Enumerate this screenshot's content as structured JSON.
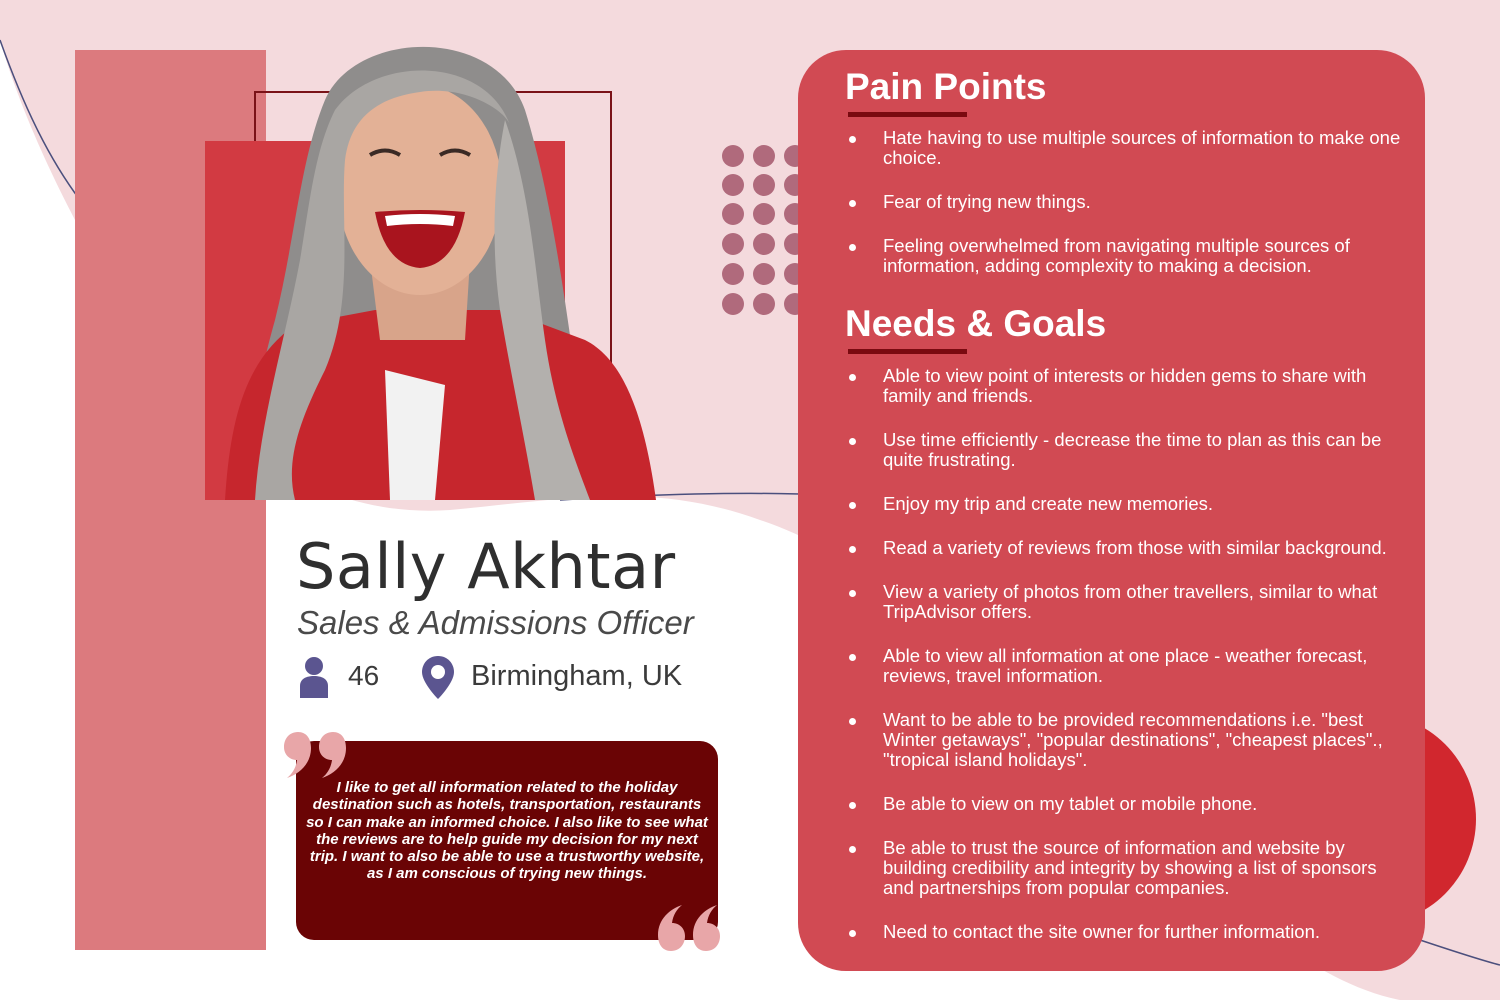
{
  "persona": {
    "name": "Sally Akhtar",
    "job_title": "Sales & Admissions Officer",
    "age": "46",
    "location": "Birmingham, UK",
    "quote": "I like to get all information related to the holiday destination such as hotels, transportation, restaurants so I can make an informed choice. I also like to see what the reviews are to help guide my decision for my next trip. I want to also be able to use a trustworthy website, as I am conscious of trying new things."
  },
  "icons": {
    "age": "person-icon",
    "location": "map-pin-icon",
    "quote_open": "quote-open-icon",
    "quote_close": "quote-close-icon"
  },
  "colors": {
    "accent": "#d14a53",
    "dark_accent": "#6a0405",
    "band": "#dc7a7e",
    "blush": "#f4dadd",
    "icon": "#5b5590"
  },
  "pain_points": {
    "title": "Pain Points",
    "items": [
      "Hate having to use multiple sources of information to make one choice.",
      "Fear of trying new things.",
      "Feeling overwhelmed from navigating multiple sources of information, adding complexity to making a decision."
    ]
  },
  "needs_goals": {
    "title": "Needs & Goals",
    "items": [
      "Able to view point of interests or hidden gems to share with family and friends.",
      "Use time efficiently - decrease the time to plan as this can be quite frustrating.",
      "Enjoy my trip and create new memories.",
      "Read a variety of reviews from those with similar background.",
      "View a variety of photos from other travellers, similar to what TripAdvisor offers.",
      "Able to  view all information at one place - weather forecast, reviews, travel information.",
      "Want to be able to be provided recommendations i.e. \"best Winter getaways\", \"popular destinations\", \"cheapest places\"., \"tropical island holidays\".",
      "Be able to view on my tablet or mobile phone.",
      "Be able to trust the source of information and website by building credibility and integrity by showing a list of sponsors and partnerships from popular companies.",
      "Need to contact the site owner for further information."
    ]
  }
}
